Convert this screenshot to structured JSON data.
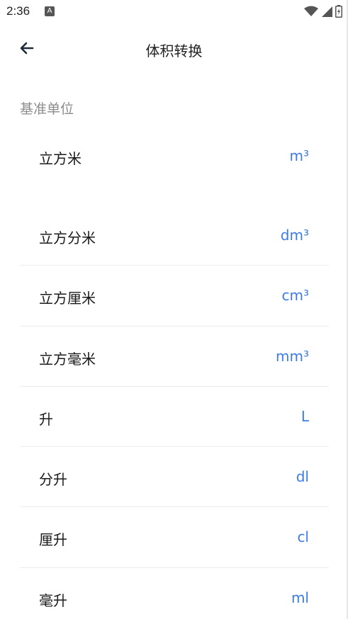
{
  "status_bar": {
    "time": "2:36",
    "notification_glyph": "A",
    "icons": [
      "wifi-icon",
      "signal-icon",
      "battery-charging-icon"
    ]
  },
  "app_bar": {
    "back_icon": "arrow-left-icon",
    "title": "体积转换"
  },
  "section": {
    "label": "基准单位"
  },
  "base_unit": {
    "name": "立方米",
    "symbol": "m³"
  },
  "units": [
    {
      "name": "立方分米",
      "symbol": "dm³"
    },
    {
      "name": "立方厘米",
      "symbol": "cm³"
    },
    {
      "name": "立方毫米",
      "symbol": "mm³"
    },
    {
      "name": "升",
      "symbol": "L"
    },
    {
      "name": "分升",
      "symbol": "dl"
    },
    {
      "name": "厘升",
      "symbol": "cl"
    },
    {
      "name": "毫升",
      "symbol": "ml"
    }
  ],
  "colors": {
    "accent": "#3d7be8",
    "muted": "#8c8c8c",
    "divider": "#ececec"
  }
}
